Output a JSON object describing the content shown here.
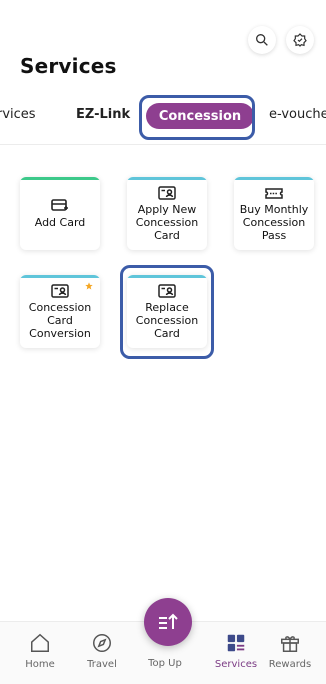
{
  "header": {
    "title": "Services"
  },
  "tabs": [
    {
      "label": "rvices"
    },
    {
      "label": "EZ-Link"
    },
    {
      "label": "Concession",
      "selected": true
    },
    {
      "label": "e-vouche"
    }
  ],
  "cards": [
    {
      "label": "Add Card",
      "icon": "add-card-icon"
    },
    {
      "label": "Apply New Concession Card",
      "icon": "id-card-icon"
    },
    {
      "label": "Buy Monthly Concession Pass",
      "icon": "ticket-icon"
    },
    {
      "label": "Concession Card Conversion",
      "icon": "id-card-icon",
      "badge": "star-icon"
    },
    {
      "label": "Replace Concession Card",
      "icon": "id-card-icon"
    }
  ],
  "nav": [
    {
      "label": "Home"
    },
    {
      "label": "Travel"
    },
    {
      "label": "Top Up"
    },
    {
      "label": "Services",
      "selected": true
    },
    {
      "label": "Rewards"
    }
  ],
  "colors": {
    "accent": "#8e3f90",
    "highlight_outline": "#3c5ca8",
    "card_bar_green": "#3cc98a",
    "card_bar_blue": "#5fc5da",
    "badge_star": "#f5a623"
  }
}
